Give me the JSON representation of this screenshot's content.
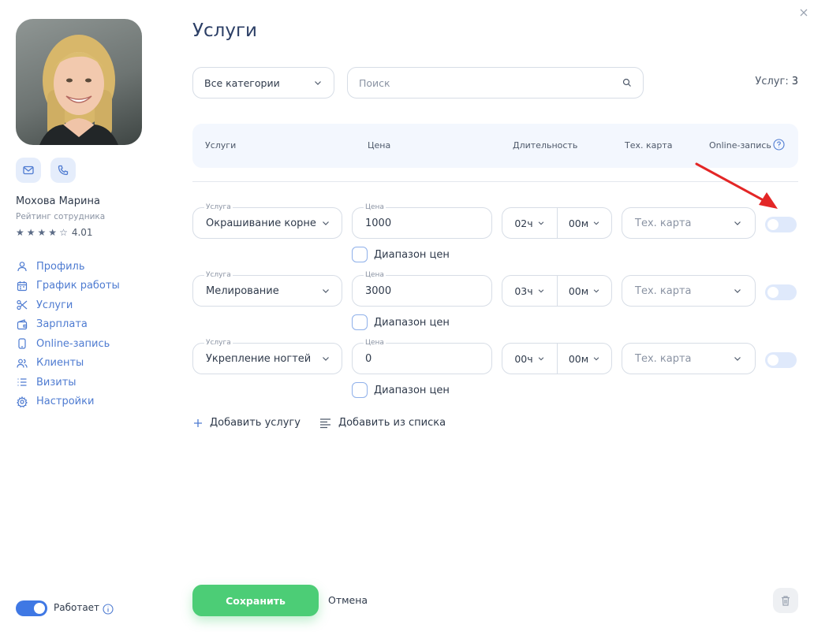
{
  "employee": {
    "name": "Мохова Марина",
    "rating_label": "Рейтинг сотрудника",
    "rating": 4.01,
    "rating_text": "4.01",
    "stars_filled": 4,
    "stars_total": 5
  },
  "nav": [
    {
      "label": "Профиль",
      "icon": "user-icon"
    },
    {
      "label": "График работы",
      "icon": "calendar-icon"
    },
    {
      "label": "Услуги",
      "icon": "scissors-icon"
    },
    {
      "label": "Зарплата",
      "icon": "wallet-icon"
    },
    {
      "label": "Online-запись",
      "icon": "phone-icon"
    },
    {
      "label": "Клиенты",
      "icon": "users-icon"
    },
    {
      "label": "Визиты",
      "icon": "list-icon"
    },
    {
      "label": "Настройки",
      "icon": "gear-icon"
    }
  ],
  "status": {
    "label": "Работает",
    "on": true
  },
  "page": {
    "title": "Услуги"
  },
  "filters": {
    "category": "Все категории",
    "search_placeholder": "Поиск",
    "count_label": "Услуг:",
    "count_value": "3"
  },
  "table": {
    "headers": [
      "Услуги",
      "Цена",
      "Длительность",
      "Тех. карта",
      "Online-запись"
    ],
    "service_label": "Услуга",
    "price_label": "Цена",
    "tech_placeholder": "Тех. карта",
    "range_label": "Диапазон цен",
    "rows": [
      {
        "service": "Окрашивание корней",
        "price": "1000",
        "hours": "02ч",
        "minutes": "00м",
        "online": false
      },
      {
        "service": "Мелирование",
        "price": "3000",
        "hours": "03ч",
        "minutes": "00м",
        "online": false
      },
      {
        "service": "Укрепление ногтей",
        "price": "0",
        "hours": "00ч",
        "minutes": "00м",
        "online": false
      }
    ]
  },
  "actions": {
    "add_service": "Добавить услугу",
    "add_from_list": "Добавить из списка",
    "save": "Сохранить",
    "cancel": "Отмена"
  },
  "colors": {
    "accent": "#4e7bd1",
    "save": "#4ccd76",
    "annotation_arrow": "#e32626"
  }
}
